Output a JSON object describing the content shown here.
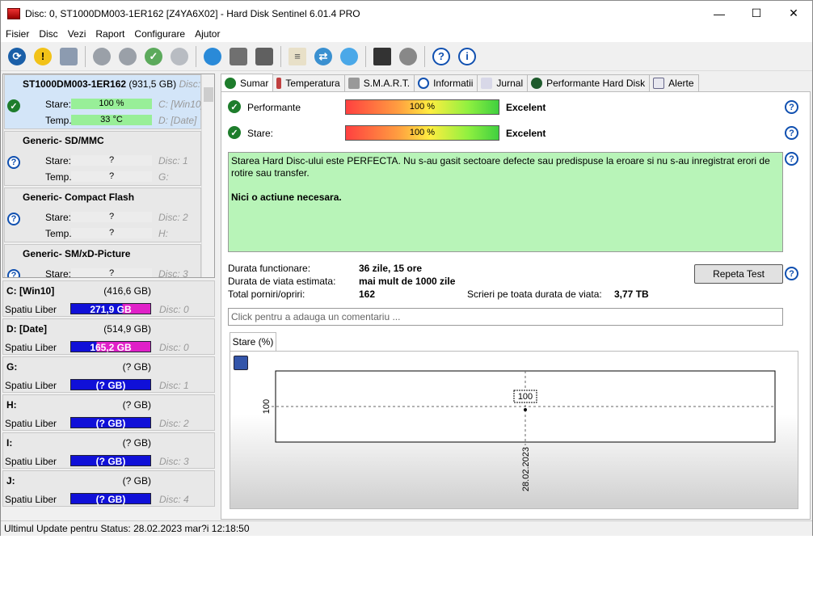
{
  "window": {
    "title": "Disc: 0, ST1000DM003-1ER162 [Z4YA6X02]  -  Hard Disk Sentinel 6.01.4 PRO",
    "minimize": "—",
    "maximize": "☐",
    "close": "✕"
  },
  "menu": [
    "Fisier",
    "Disc",
    "Vezi",
    "Raport",
    "Configurare",
    "Ajutor"
  ],
  "disks": [
    {
      "name": "ST1000DM003-1ER162",
      "size": "(931,5 GB)",
      "disc": "Disc: 0",
      "stare_label": "Stare:",
      "stare": "100 %",
      "temp_label": "Temp.:",
      "temp": "33 °C",
      "part1": "C: [Win10]",
      "part2": "D: [Date]"
    },
    {
      "name": "Generic- SD/MMC",
      "stare_label": "Stare:",
      "stare": "?",
      "temp_label": "Temp.:",
      "temp": "?",
      "part1": "Disc: 1",
      "part2": "G:"
    },
    {
      "name": "Generic- Compact Flash",
      "stare_label": "Stare:",
      "stare": "?",
      "temp_label": "Temp.:",
      "temp": "?",
      "part1": "Disc: 2",
      "part2": "H:"
    },
    {
      "name": "Generic- SM/xD-Picture",
      "stare_label": "Stare:",
      "stare": "?",
      "part1": "Disc: 3"
    }
  ],
  "partitions": [
    {
      "name": "C: [Win10]",
      "size": "(416,6 GB)",
      "free_label": "Spatiu Liber",
      "free": "271,9 GB",
      "disc": "Disc: 0",
      "fill": 0.65
    },
    {
      "name": "D: [Date]",
      "size": "(514,9 GB)",
      "free_label": "Spatiu Liber",
      "free": "165,2 GB",
      "disc": "Disc: 0",
      "fill": 0.32
    },
    {
      "name": "G:",
      "size": "(? GB)",
      "free_label": "Spatiu Liber",
      "free": "(? GB)",
      "disc": "Disc: 1",
      "fill": 1
    },
    {
      "name": "H:",
      "size": "(? GB)",
      "free_label": "Spatiu Liber",
      "free": "(? GB)",
      "disc": "Disc: 2",
      "fill": 1
    },
    {
      "name": "I:",
      "size": "(? GB)",
      "free_label": "Spatiu Liber",
      "free": "(? GB)",
      "disc": "Disc: 3",
      "fill": 1
    },
    {
      "name": "J:",
      "size": "(? GB)",
      "free_label": "Spatiu Liber",
      "free": "(? GB)",
      "disc": "Disc: 4",
      "fill": 1
    }
  ],
  "tabs": [
    "Sumar",
    "Temperatura",
    "S.M.A.R.T.",
    "Informatii",
    "Jurnal",
    "Performante Hard Disk",
    "Alerte"
  ],
  "summary": {
    "perf_label": "Performante",
    "perf_value": "100 %",
    "perf_rating": "Excelent",
    "stare_label": "Stare:",
    "stare_value": "100 %",
    "stare_rating": "Excelent",
    "message": "Starea Hard Disc-ului este PERFECTA. Nu s-au gasit sectoare defecte sau predispuse la eroare si nu s-au inregistrat erori de rotire sau transfer.",
    "action": "Nici o actiune necesara.",
    "uptime_label": "Durata functionare:",
    "uptime": "36 zile, 15 ore",
    "life_label": "Durata de viata estimata:",
    "life": "mai mult de 1000 zile",
    "starts_label": "Total porniri/opriri:",
    "starts": "162",
    "writes_label": "Scrieri pe toata durata de viata:",
    "writes": "3,77 TB",
    "repeat_button": "Repeta Test",
    "comment_placeholder": "Click pentru a adauga un comentariu ..."
  },
  "chart_tab": "Stare (%)",
  "chart_data": {
    "type": "line",
    "x": [
      "28.02.2023"
    ],
    "series": [
      {
        "values": [
          100
        ]
      }
    ],
    "ylabel": "",
    "yticks": [
      100
    ],
    "data_labels": [
      "100"
    ]
  },
  "status": "Ultimul Update pentru Status: 28.02.2023 mar?i 12:18:50",
  "colors": {
    "ok": "#1e7d2c",
    "help": "#1050b0",
    "partbar": "#1010d8",
    "partfill": "#e020c8",
    "message_bg": "#b8f4b8"
  }
}
